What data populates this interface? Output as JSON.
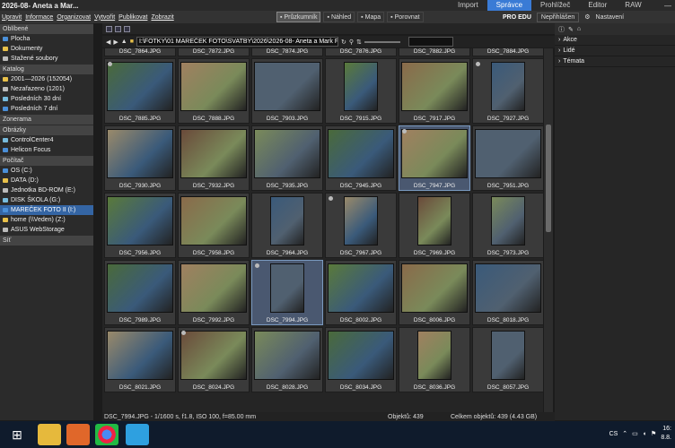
{
  "window": {
    "title": "2026-08- Aneta a Mar..."
  },
  "modes": [
    "Import",
    "Správce",
    "Prohlížeč",
    "Editor",
    "RAW"
  ],
  "active_mode": "Správce",
  "menu": [
    "Upravit",
    "Informace",
    "Organizovat",
    "Vytvořit",
    "Publikovat",
    "Zobrazit"
  ],
  "view_buttons": [
    {
      "label": "Průzkumník",
      "active": true
    },
    {
      "label": "Náhled",
      "active": false
    },
    {
      "label": "Mapa",
      "active": false
    },
    {
      "label": "Porovnat",
      "active": false
    }
  ],
  "right_bar": {
    "edition": "PRO EDU",
    "unsigned": "Nepřihlášen",
    "settings": "Nastavení"
  },
  "sidebar": {
    "sections": [
      {
        "title": "Oblíbené",
        "items": [
          "Plocha",
          "Dokumenty",
          "Stažené soubory"
        ]
      },
      {
        "title": "Katalog",
        "items": [
          "2001—2026 (152054)",
          "Nezařazeno (1201)",
          "Posledních 30 dní",
          "Posledních 7 dní"
        ]
      },
      {
        "title": "Zonerama",
        "items": []
      },
      {
        "title": "Obrázky",
        "items": [
          "ControlCenter4",
          "Helicon Focus"
        ]
      },
      {
        "title": "Počítač",
        "items": [
          "OS (C:)",
          "DATA (D:)",
          "Jednotka BD-ROM (E:)",
          "DISK ŠKOLA (G:)",
          "MAREČEK FOTO II (I:)",
          "home (\\\\Veden) (Z:)",
          "ASUS WebStorage"
        ]
      },
      {
        "title": "Síť",
        "items": []
      }
    ],
    "selected": "MAREČEK FOTO II (I:)"
  },
  "address": {
    "path": "I:\\FOTKY\\01 MAREČEK FOTO\\SVATBY\\2026\\2026-08- Aneta a Mark F"
  },
  "thumbnails": [
    "DSC_7864.JPG",
    "DSC_7872.JPG",
    "DSC_7874.JPG",
    "DSC_7876.JPG",
    "DSC_7882.JPG",
    "DSC_7884.JPG",
    "DSC_7885.JPG",
    "DSC_7888.JPG",
    "DSC_7903.JPG",
    "DSC_7915.JPG",
    "DSC_7917.JPG",
    "DSC_7927.JPG",
    "DSC_7930.JPG",
    "DSC_7932.JPG",
    "DSC_7935.JPG",
    "DSC_7945.JPG",
    "DSC_7947.JPG",
    "DSC_7951.JPG",
    "DSC_7956.JPG",
    "DSC_7958.JPG",
    "DSC_7964.JPG",
    "DSC_7967.JPG",
    "DSC_7969.JPG",
    "DSC_7973.JPG",
    "DSC_7989.JPG",
    "DSC_7992.JPG",
    "DSC_7994.JPG",
    "DSC_8002.JPG",
    "DSC_8006.JPG",
    "DSC_8018.JPG",
    "DSC_8021.JPG",
    "DSC_8024.JPG",
    "DSC_8028.JPG",
    "DSC_8034.JPG",
    "DSC_8036.JPG",
    "DSC_8057.JPG"
  ],
  "selected_thumbs": [
    "DSC_7947.JPG",
    "DSC_7994.JPG"
  ],
  "right_panel": {
    "sections": [
      "Akce",
      "Lidé",
      "Témata"
    ]
  },
  "status": {
    "info": "DSC_7994.JPG - 1/1600 s, f1.8, ISO 100, f=85.00 mm",
    "objects": "Objektů: 439",
    "total": "Celkem objektů: 439 (4.43 GB)"
  },
  "taskbar": {
    "lang": "CS",
    "time": "16:",
    "date": "8.8."
  },
  "colors": {
    "accent": "#3a7bd5",
    "selection": "#3465a4"
  }
}
